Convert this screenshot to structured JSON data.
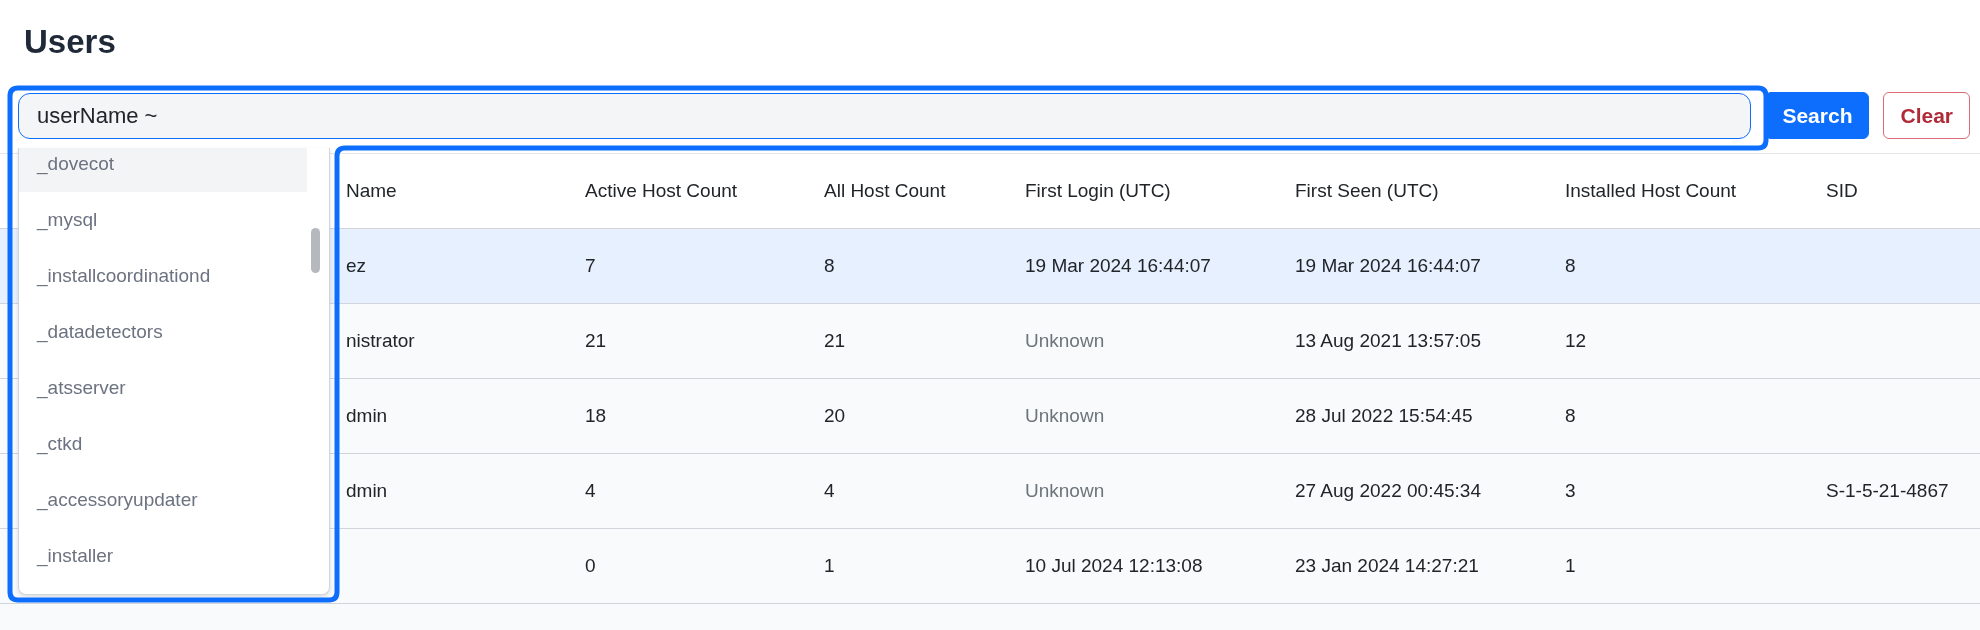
{
  "title": "Users",
  "search": {
    "value": "userName ~",
    "button": "Search",
    "clear": "Clear"
  },
  "suggestions": [
    {
      "label": "_dovecot",
      "selected": true
    },
    {
      "label": "_mysql",
      "selected": false
    },
    {
      "label": "_installcoordinationd",
      "selected": false
    },
    {
      "label": "_datadetectors",
      "selected": false
    },
    {
      "label": "_atsserver",
      "selected": false
    },
    {
      "label": "_ctkd",
      "selected": false
    },
    {
      "label": "_accessoryupdater",
      "selected": false
    },
    {
      "label": "_installer",
      "selected": false
    }
  ],
  "table": {
    "columns": [
      "Name",
      "Active Host Count",
      "All Host Count",
      "First Login (UTC)",
      "First Seen (UTC)",
      "Installed Host Count",
      "SID"
    ],
    "rows": [
      {
        "selected": true,
        "user_name": "ez",
        "active_host_count": "7",
        "all_host_count": "8",
        "first_login": {
          "text": "19 Mar 2024 16:44:07",
          "dim": false
        },
        "first_seen": "19 Mar 2024 16:44:07",
        "installed_host_count": "8"
      },
      {
        "selected": false,
        "user_name": "nistrator",
        "active_host_count": "21",
        "all_host_count": "21",
        "first_login": {
          "text": "Unknown",
          "dim": true
        },
        "first_seen": "13 Aug 2021 13:57:05",
        "installed_host_count": "12"
      },
      {
        "selected": false,
        "user_name": "dmin",
        "active_host_count": "18",
        "all_host_count": "20",
        "first_login": {
          "text": "Unknown",
          "dim": true
        },
        "first_seen": "28 Jul 2022 15:54:45",
        "installed_host_count": "8"
      },
      {
        "selected": false,
        "user_name": "dmin",
        "active_host_count": "4",
        "all_host_count": "4",
        "first_login": {
          "text": "Unknown",
          "dim": true
        },
        "first_seen": "27 Aug 2022 00:45:34",
        "installed_host_count": "3",
        "sid": "S-1-5-21-4867"
      },
      {
        "selected": false,
        "active_host_count": "0",
        "all_host_count": "1",
        "first_login": {
          "text": "10 Jul 2024 12:13:08",
          "dim": false
        },
        "first_seen": "23 Jan 2024 14:27:21",
        "installed_host_count": "1"
      }
    ]
  }
}
